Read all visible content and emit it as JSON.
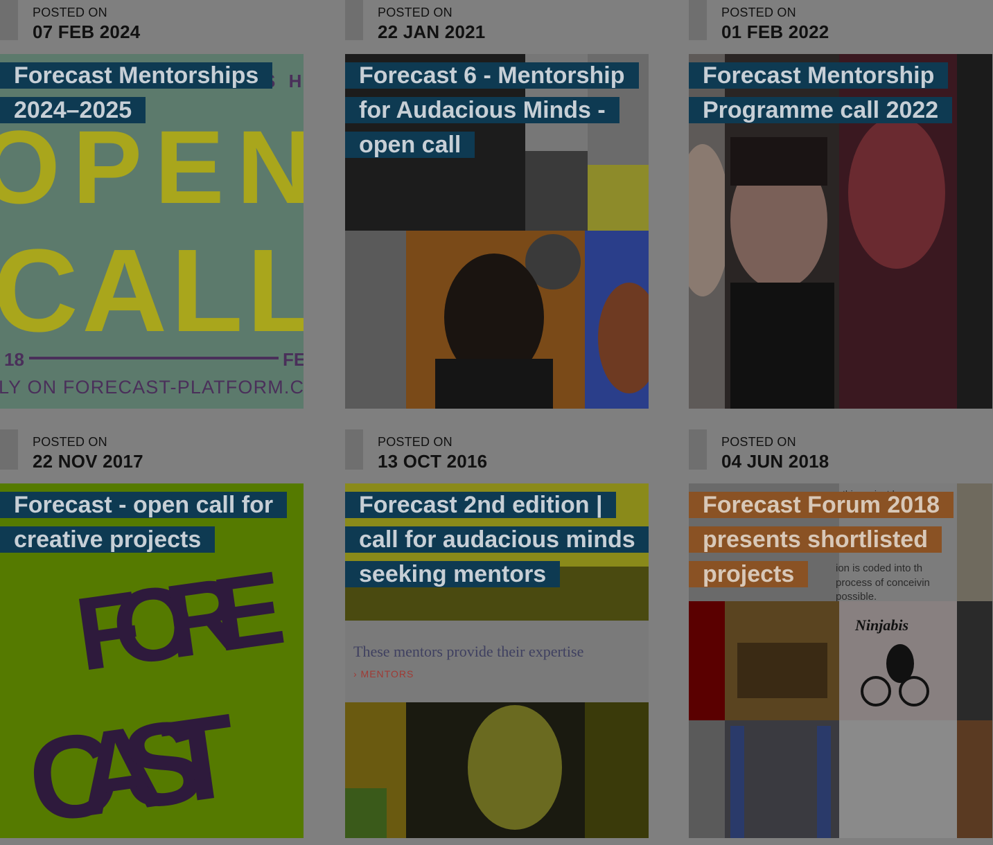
{
  "posted_label": "POSTED ON",
  "cards": [
    {
      "date": "07 FEB 2024",
      "title": "Forecast Mentorships 2024–2025",
      "image": "open-call-poster"
    },
    {
      "date": "22 JAN 2021",
      "title": "Forecast 6 - Mentorship for Audacious Minds - open call",
      "image": "mentors-collage"
    },
    {
      "date": "01 FEB 2022",
      "title": "Forecast Mentorship Programme call 2022",
      "image": "portrait-collage"
    },
    {
      "date": "22 NOV 2017",
      "title": "Forecast - open call for creative projects",
      "image": "forecast-logo"
    },
    {
      "date": "13 OCT 2016",
      "title": "Forecast 2nd edition | call for audacious minds seeking mentors",
      "image": "mentors-expertise-collage"
    },
    {
      "date": "04 JUN 2018",
      "title": "Forecast Forum 2018 presents shortlisted projects",
      "image": "projects-collage"
    }
  ],
  "image_text": {
    "open_call": {
      "line1": "OPEN",
      "line2": "CALL",
      "num": "18",
      "abbr": "FE",
      "footer": "LY ON FORECAST-PLATFORM.C",
      "top": "S H I"
    },
    "forecast_logo": {
      "line1": "FORE",
      "line2": "CAST"
    },
    "mentors_note": {
      "text": "These mentors provide their expertise",
      "link": "› MENTORS"
    },
    "ninjabis": "Ninjabis",
    "projects_text": {
      "a": "this project has",
      "b": "ion is coded into th",
      "c": "process of conceivin",
      "d": "possible."
    }
  },
  "colors": {
    "page_bg": "#7f7f7f",
    "title_bg": "#0e3a52",
    "title_bg_highlight": "#8a5224",
    "title_text": "#c7cfd6"
  }
}
